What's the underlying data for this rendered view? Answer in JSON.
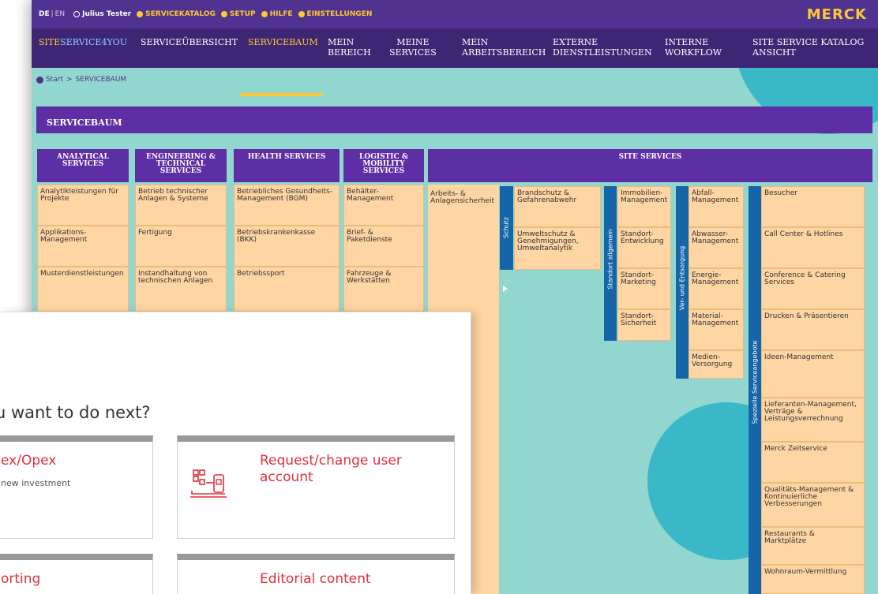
{
  "topbar": {
    "lang_de": "DE",
    "lang_sep": "|",
    "lang_en": "EN",
    "user": "Julius Tester",
    "links": [
      "SERVICEKATALOG",
      "SETUP",
      "HILFE",
      "EINSTELLUNGEN"
    ],
    "logo": "MERCK"
  },
  "nav": {
    "brand_a": "SITE",
    "brand_b": "SERVICE4YOU",
    "items": [
      "SERVICEÜBERSICHT",
      "SERVICEBAUM",
      "MEIN\nBEREICH",
      "MEINE\nSERVICES",
      "MEIN\nARBEITSBEREICH",
      "EXTERNE\nDIENSTLEISTUNGEN",
      "INTERNE\nWORKFLOW",
      "SITE SERVICE KATALOG\nANSICHT"
    ]
  },
  "breadcrumb": {
    "home": "Start",
    "sep": ">",
    "current": "SERVICEBAUM"
  },
  "page_title": "SERVICEBAUM",
  "columns": [
    {
      "header": "ANALYTICAL\nSERVICES",
      "cells": [
        "Analytikleistungen für Projekte",
        "Applikations-\nManagement",
        "Musterdienstleistungen"
      ]
    },
    {
      "header": "ENGINEERING &\nTECHNICAL\nSERVICES",
      "cells": [
        "Betrieb technischer Anlagen & Systeme",
        "Fertigung",
        "Instandhaltung von technischen Anlagen"
      ]
    },
    {
      "header": "HEALTH SERVICES",
      "cells": [
        "Betriebliches Gesundheits-Management (BGM)",
        "Betriebskrankenkasse (BKK)",
        "Betriebssport"
      ]
    },
    {
      "header": "LOGISTIC &\nMOBILITY\nSERVICES",
      "cells": [
        "Behälter-\nManagement",
        "Brief- &\nPaketdienste",
        "Fahrzeuge &\nWerkstätten"
      ]
    }
  ],
  "site_services": {
    "header": "SITE SERVICES",
    "arbeits": "Arbeits- &\nAnlagensicherheit",
    "schutz_label": "Schutz",
    "schutz": [
      "Brandschutz &\nGefahrenabwehr",
      "Umweltschutz &\nGenehmigungen,\nUmweltanalytik"
    ],
    "standort_label": "Standort allgemein",
    "standort": [
      "Immobilien-\nManagement",
      "Standort-\nEntwicklung",
      "Standort-\nMarketing",
      "Standort-\nSicherheit"
    ],
    "ver_label": "Ver- und Entsorgung",
    "ver": [
      "Abfall-\nManagement",
      "Abwasser-\nManagement",
      "Energie-\nManagement",
      "Material-\nManagement",
      "Medien-\nVersorgung"
    ],
    "spez_label": "Spezielle Serviceangebote",
    "spez": [
      "Besucher",
      "Call Center & Hotlines",
      "Conference & Catering\nServices",
      "Drucken & Präsentieren",
      "Ideen-Management",
      "Lieferanten-Management,\nVerträge &\nLeistungsverrechnung",
      "Merck Zeitservice",
      "Qualitäts-Management &\nKontinuierliche\nVerbesserungen",
      "Restaurants &\nMarktplätze",
      "Wohnraum-Vermittlung"
    ]
  },
  "overlay": {
    "heading": "u want to do next?",
    "cards": [
      {
        "title": "ex/Opex",
        "subtitle": "new investment"
      },
      {
        "title": "Request/change user\naccount",
        "subtitle": ""
      },
      {
        "title": "orting",
        "subtitle": ""
      },
      {
        "title": "Editorial content",
        "subtitle": ""
      }
    ]
  },
  "colors": {
    "purple": "#503291",
    "header_purple": "#5e2ea5",
    "gold": "#ffc832",
    "teal_bg": "#92d7cf",
    "teal_circle": "#3bb8c8",
    "cell_peach": "#ffd5a3",
    "category_blue": "#1565a8",
    "card_red": "#e0303a"
  }
}
